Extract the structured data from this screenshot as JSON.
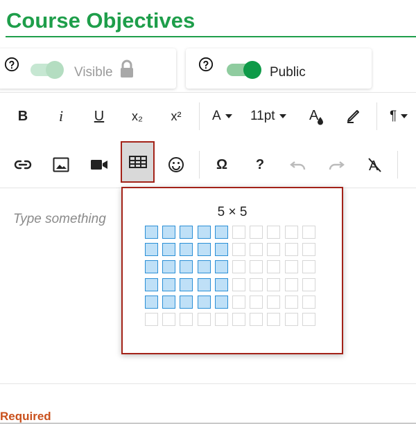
{
  "header": {
    "title": "Course Objectives"
  },
  "visibility": {
    "label": "Visible",
    "state": "off"
  },
  "access": {
    "label": "Public",
    "state": "on"
  },
  "toolbar": {
    "bold": "B",
    "italic": "i",
    "underline": "U",
    "subscript": "x₂",
    "superscript": "x²",
    "font_color": "A",
    "font_size": "11pt",
    "special_char": "Ω",
    "help": "?",
    "paragraph": "¶"
  },
  "editor": {
    "placeholder": "Type something"
  },
  "table_picker": {
    "label": "5 × 5",
    "selected_rows": 5,
    "selected_cols": 5,
    "total_rows": 6,
    "total_cols": 10
  },
  "footer": {
    "required": "Required"
  },
  "colors": {
    "accent": "#1e9e4a",
    "highlight_border": "#a32218",
    "required": "#c9501c",
    "selection": "#bfe0f7"
  }
}
